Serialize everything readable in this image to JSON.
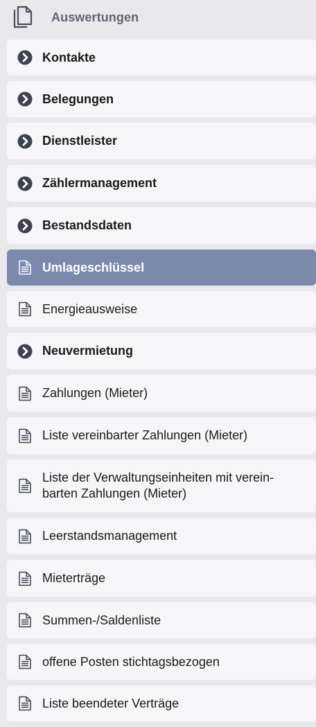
{
  "header": {
    "title": "Auswertungen",
    "icon": "documents-icon"
  },
  "colors": {
    "background": "#e9e9ec",
    "item_background": "#f6f6f8",
    "active_background": "#7a89ac",
    "chevron": "#3d4250",
    "header_text": "#5f6472"
  },
  "items": [
    {
      "label": "Kontakte",
      "type": "folder",
      "icon": "chevron-right-circle-icon"
    },
    {
      "label": "Belegungen",
      "type": "folder",
      "icon": "chevron-right-circle-icon"
    },
    {
      "label": "Dienstleister",
      "type": "folder",
      "icon": "chevron-right-circle-icon"
    },
    {
      "label": "Zählermanagement",
      "type": "folder",
      "icon": "chevron-right-circle-icon"
    },
    {
      "label": "Bestandsdaten",
      "type": "folder",
      "icon": "chevron-right-circle-icon"
    },
    {
      "label": "Umlageschlüssel",
      "type": "report",
      "icon": "document-icon",
      "active": true
    },
    {
      "label": "Energieausweise",
      "type": "report",
      "icon": "document-icon"
    },
    {
      "label": "Neuvermietung",
      "type": "folder",
      "icon": "chevron-right-circle-icon"
    },
    {
      "label": "Zahlungen (Mieter)",
      "type": "report",
      "icon": "document-icon"
    },
    {
      "label": "Liste vereinbarter Zahlungen (Mieter)",
      "type": "report",
      "icon": "document-icon"
    },
    {
      "label": "Liste der Verwaltungseinheiten mit verein-barten Zahlungen (Mieter)",
      "type": "report",
      "icon": "document-icon"
    },
    {
      "label": "Leerstandsmanagement",
      "type": "report",
      "icon": "document-icon"
    },
    {
      "label": "Mieterträge",
      "type": "report",
      "icon": "document-icon"
    },
    {
      "label": "Summen-/Saldenliste",
      "type": "report",
      "icon": "document-icon"
    },
    {
      "label": "offene Posten stichtagsbezogen",
      "type": "report",
      "icon": "document-icon"
    },
    {
      "label": "Liste beendeter Verträge",
      "type": "report",
      "icon": "document-icon"
    }
  ]
}
